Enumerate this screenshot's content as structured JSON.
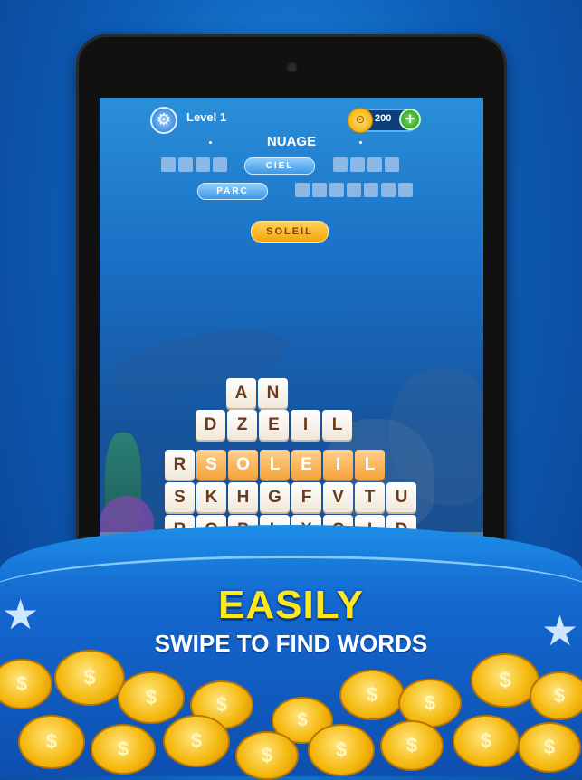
{
  "game": {
    "level_label": "Level 1",
    "coins": "200",
    "current_word_hint": "NUAGE",
    "word_list": {
      "row1_left_blanks": 4,
      "row1_found": "CIEL",
      "row1_right_blanks": 4,
      "row2_found": "PARC",
      "row2_right_blanks": 7
    },
    "selected_word": "SOLEIL",
    "grid": [
      [
        "A",
        "N"
      ],
      [
        "D",
        "Z",
        "E",
        "I",
        "L"
      ],
      [
        "R",
        "S",
        "O",
        "L",
        "E",
        "I",
        "L"
      ],
      [
        "S",
        "K",
        "H",
        "G",
        "F",
        "V",
        "T",
        "U"
      ],
      [
        "R",
        "O",
        "P",
        "L",
        "X",
        "C",
        "I",
        "D"
      ]
    ]
  },
  "promo": {
    "headline": "EASILY",
    "subline": "SWIPE TO FIND WORDS"
  },
  "icons": {
    "settings": "gear-icon",
    "coin": "coin-icon",
    "add": "plus-icon",
    "star": "star-icon"
  },
  "colors": {
    "headline": "#ffe81a",
    "highlight_tile": "#f5a23a",
    "accent_blue": "#1d8fe8"
  }
}
